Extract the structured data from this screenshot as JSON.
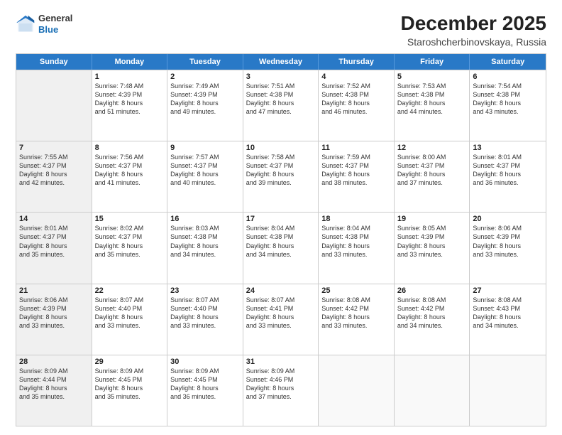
{
  "logo": {
    "line1": "General",
    "line2": "Blue"
  },
  "title": "December 2025",
  "subtitle": "Staroshcherbinovskaya, Russia",
  "header_days": [
    "Sunday",
    "Monday",
    "Tuesday",
    "Wednesday",
    "Thursday",
    "Friday",
    "Saturday"
  ],
  "weeks": [
    [
      {
        "day": "",
        "info": "",
        "shaded": true
      },
      {
        "day": "1",
        "info": "Sunrise: 7:48 AM\nSunset: 4:39 PM\nDaylight: 8 hours\nand 51 minutes."
      },
      {
        "day": "2",
        "info": "Sunrise: 7:49 AM\nSunset: 4:39 PM\nDaylight: 8 hours\nand 49 minutes."
      },
      {
        "day": "3",
        "info": "Sunrise: 7:51 AM\nSunset: 4:38 PM\nDaylight: 8 hours\nand 47 minutes."
      },
      {
        "day": "4",
        "info": "Sunrise: 7:52 AM\nSunset: 4:38 PM\nDaylight: 8 hours\nand 46 minutes."
      },
      {
        "day": "5",
        "info": "Sunrise: 7:53 AM\nSunset: 4:38 PM\nDaylight: 8 hours\nand 44 minutes."
      },
      {
        "day": "6",
        "info": "Sunrise: 7:54 AM\nSunset: 4:38 PM\nDaylight: 8 hours\nand 43 minutes."
      }
    ],
    [
      {
        "day": "7",
        "info": "Sunrise: 7:55 AM\nSunset: 4:37 PM\nDaylight: 8 hours\nand 42 minutes.",
        "shaded": true
      },
      {
        "day": "8",
        "info": "Sunrise: 7:56 AM\nSunset: 4:37 PM\nDaylight: 8 hours\nand 41 minutes."
      },
      {
        "day": "9",
        "info": "Sunrise: 7:57 AM\nSunset: 4:37 PM\nDaylight: 8 hours\nand 40 minutes."
      },
      {
        "day": "10",
        "info": "Sunrise: 7:58 AM\nSunset: 4:37 PM\nDaylight: 8 hours\nand 39 minutes."
      },
      {
        "day": "11",
        "info": "Sunrise: 7:59 AM\nSunset: 4:37 PM\nDaylight: 8 hours\nand 38 minutes."
      },
      {
        "day": "12",
        "info": "Sunrise: 8:00 AM\nSunset: 4:37 PM\nDaylight: 8 hours\nand 37 minutes."
      },
      {
        "day": "13",
        "info": "Sunrise: 8:01 AM\nSunset: 4:37 PM\nDaylight: 8 hours\nand 36 minutes."
      }
    ],
    [
      {
        "day": "14",
        "info": "Sunrise: 8:01 AM\nSunset: 4:37 PM\nDaylight: 8 hours\nand 35 minutes.",
        "shaded": true
      },
      {
        "day": "15",
        "info": "Sunrise: 8:02 AM\nSunset: 4:37 PM\nDaylight: 8 hours\nand 35 minutes."
      },
      {
        "day": "16",
        "info": "Sunrise: 8:03 AM\nSunset: 4:38 PM\nDaylight: 8 hours\nand 34 minutes."
      },
      {
        "day": "17",
        "info": "Sunrise: 8:04 AM\nSunset: 4:38 PM\nDaylight: 8 hours\nand 34 minutes."
      },
      {
        "day": "18",
        "info": "Sunrise: 8:04 AM\nSunset: 4:38 PM\nDaylight: 8 hours\nand 33 minutes."
      },
      {
        "day": "19",
        "info": "Sunrise: 8:05 AM\nSunset: 4:39 PM\nDaylight: 8 hours\nand 33 minutes."
      },
      {
        "day": "20",
        "info": "Sunrise: 8:06 AM\nSunset: 4:39 PM\nDaylight: 8 hours\nand 33 minutes."
      }
    ],
    [
      {
        "day": "21",
        "info": "Sunrise: 8:06 AM\nSunset: 4:39 PM\nDaylight: 8 hours\nand 33 minutes.",
        "shaded": true
      },
      {
        "day": "22",
        "info": "Sunrise: 8:07 AM\nSunset: 4:40 PM\nDaylight: 8 hours\nand 33 minutes."
      },
      {
        "day": "23",
        "info": "Sunrise: 8:07 AM\nSunset: 4:40 PM\nDaylight: 8 hours\nand 33 minutes."
      },
      {
        "day": "24",
        "info": "Sunrise: 8:07 AM\nSunset: 4:41 PM\nDaylight: 8 hours\nand 33 minutes."
      },
      {
        "day": "25",
        "info": "Sunrise: 8:08 AM\nSunset: 4:42 PM\nDaylight: 8 hours\nand 33 minutes."
      },
      {
        "day": "26",
        "info": "Sunrise: 8:08 AM\nSunset: 4:42 PM\nDaylight: 8 hours\nand 34 minutes."
      },
      {
        "day": "27",
        "info": "Sunrise: 8:08 AM\nSunset: 4:43 PM\nDaylight: 8 hours\nand 34 minutes."
      }
    ],
    [
      {
        "day": "28",
        "info": "Sunrise: 8:09 AM\nSunset: 4:44 PM\nDaylight: 8 hours\nand 35 minutes.",
        "shaded": true
      },
      {
        "day": "29",
        "info": "Sunrise: 8:09 AM\nSunset: 4:45 PM\nDaylight: 8 hours\nand 35 minutes."
      },
      {
        "day": "30",
        "info": "Sunrise: 8:09 AM\nSunset: 4:45 PM\nDaylight: 8 hours\nand 36 minutes."
      },
      {
        "day": "31",
        "info": "Sunrise: 8:09 AM\nSunset: 4:46 PM\nDaylight: 8 hours\nand 37 minutes."
      },
      {
        "day": "",
        "info": "",
        "shaded": false
      },
      {
        "day": "",
        "info": "",
        "shaded": false
      },
      {
        "day": "",
        "info": "",
        "shaded": false
      }
    ]
  ]
}
